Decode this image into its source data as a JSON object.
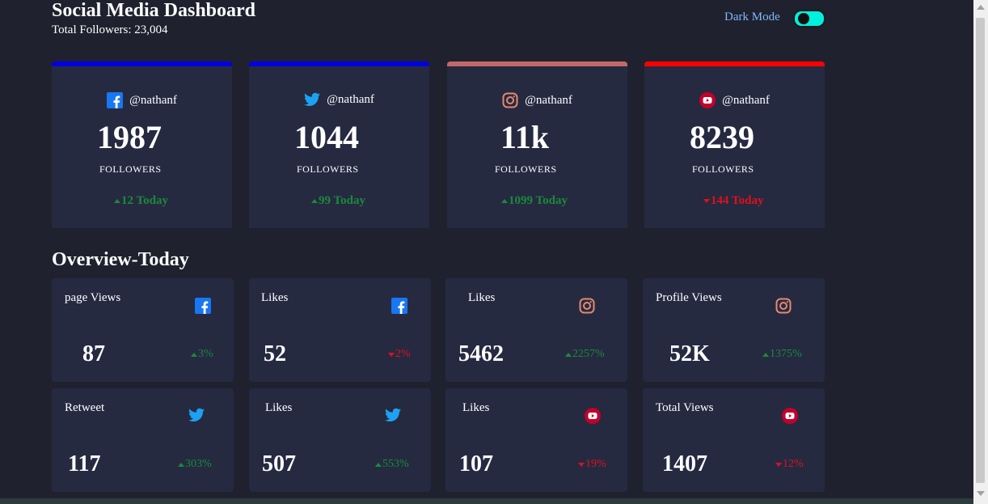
{
  "header": {
    "title": "Social Media Dashboard",
    "total_followers": "Total Followers: 23,004"
  },
  "dark_mode": {
    "label": "Dark Mode",
    "enabled": true
  },
  "colors": {
    "facebook": "#1877f2",
    "twitter": "#1da1f2",
    "instagram_bar": "#c4686a",
    "youtube": "#e0001a",
    "up": "#1b8a3a",
    "down": "#e0101a",
    "card_bg": "#252a41",
    "page_bg": "#1f212e"
  },
  "cards": [
    {
      "platform": "facebook",
      "icon": "facebook-icon",
      "handle": "@nathanf",
      "count": "1987",
      "label": "FOLLOWERS",
      "today": "12 Today",
      "trend": "up",
      "bar_color": "#0000e0"
    },
    {
      "platform": "twitter",
      "icon": "twitter-icon",
      "handle": "@nathanf",
      "count": "1044",
      "label": "FOLLOWERS",
      "today": "99 Today",
      "trend": "up",
      "bar_color": "#0000e0"
    },
    {
      "platform": "instagram",
      "icon": "instagram-icon",
      "handle": "@nathanf",
      "count": "11k",
      "label": "FOLLOWERS",
      "today": "1099 Today",
      "trend": "up",
      "bar_color": "#c4686a"
    },
    {
      "platform": "youtube",
      "icon": "youtube-icon",
      "handle": "@nathanf",
      "count": "8239",
      "label": "FOLLOWERS",
      "today": "144 Today",
      "trend": "down",
      "bar_color": "#ff0000"
    }
  ],
  "overview": {
    "title": "Overview-Today",
    "items": [
      {
        "label": "page Views",
        "icon": "facebook-icon",
        "value": "87",
        "change": "3%",
        "trend": "up"
      },
      {
        "label": "Likes",
        "icon": "facebook-icon",
        "value": "52",
        "change": "2%",
        "trend": "down"
      },
      {
        "label": "Likes",
        "icon": "instagram-icon",
        "value": "5462",
        "change": "2257%",
        "trend": "up"
      },
      {
        "label": "Profile Views",
        "icon": "instagram-icon",
        "value": "52K",
        "change": "1375%",
        "trend": "up"
      },
      {
        "label": "Retweet",
        "icon": "twitter-icon",
        "value": "117",
        "change": "303%",
        "trend": "up"
      },
      {
        "label": "Likes",
        "icon": "twitter-icon",
        "value": "507",
        "change": "553%",
        "trend": "up"
      },
      {
        "label": "Likes",
        "icon": "youtube-icon",
        "value": "107",
        "change": "19%",
        "trend": "down"
      },
      {
        "label": "Total Views",
        "icon": "youtube-icon",
        "value": "1407",
        "change": "12%",
        "trend": "down"
      }
    ]
  }
}
